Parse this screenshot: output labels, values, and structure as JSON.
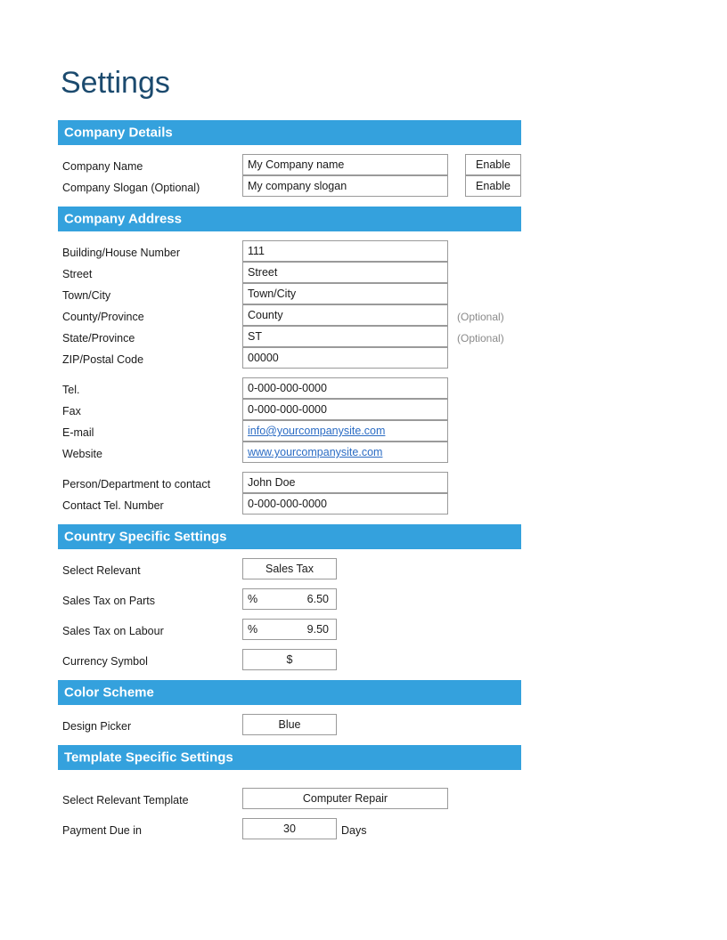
{
  "page": {
    "title": "Settings"
  },
  "sections": {
    "company_details": {
      "heading": "Company Details",
      "rows": [
        {
          "label": "Company Name",
          "value": "My Company name",
          "action": "Enable"
        },
        {
          "label": "Company Slogan (Optional)",
          "value": "My company slogan",
          "action": "Enable"
        }
      ]
    },
    "company_address": {
      "heading": "Company Address",
      "address_rows": [
        {
          "label": "Building/House Number",
          "value": "111",
          "note": ""
        },
        {
          "label": "Street",
          "value": "Street",
          "note": ""
        },
        {
          "label": "Town/City",
          "value": "Town/City",
          "note": ""
        },
        {
          "label": "County/Province",
          "value": "County",
          "note": "(Optional)"
        },
        {
          "label": "State/Province",
          "value": "ST",
          "note": "(Optional)"
        },
        {
          "label": "ZIP/Postal Code",
          "value": "00000",
          "note": ""
        }
      ],
      "contact_rows": [
        {
          "label": "Tel.",
          "value": "0-000-000-0000",
          "is_link": false
        },
        {
          "label": "Fax",
          "value": "0-000-000-0000",
          "is_link": false
        },
        {
          "label": "E-mail",
          "value": "info@yourcompanysite.com",
          "is_link": true
        },
        {
          "label": "Website",
          "value": "www.yourcompanysite.com",
          "is_link": true
        }
      ],
      "person_rows": [
        {
          "label": "Person/Department to contact",
          "value": "John Doe"
        },
        {
          "label": "Contact Tel. Number",
          "value": "0-000-000-0000"
        }
      ]
    },
    "country_specific": {
      "heading": "Country Specific Settings",
      "select_relevant": {
        "label": "Select Relevant",
        "value": "Sales Tax"
      },
      "tax_parts": {
        "label": "Sales Tax on Parts",
        "sign": "%",
        "value": "6.50"
      },
      "tax_labour": {
        "label": "Sales Tax on Labour",
        "sign": "%",
        "value": "9.50"
      },
      "currency": {
        "label": "Currency Symbol",
        "value": "$"
      }
    },
    "color_scheme": {
      "heading": "Color Scheme",
      "design_picker": {
        "label": "Design Picker",
        "value": "Blue"
      }
    },
    "template_specific": {
      "heading": "Template Specific Settings",
      "select_template": {
        "label": "Select Relevant Template",
        "value": "Computer Repair"
      },
      "payment_due": {
        "label": "Payment Due in",
        "value": "30",
        "suffix": "Days"
      }
    }
  },
  "colors": {
    "section_bar": "#34a1dd",
    "title": "#1b4a6e",
    "link": "#2b6cc4",
    "note": "#8a8a8a"
  }
}
